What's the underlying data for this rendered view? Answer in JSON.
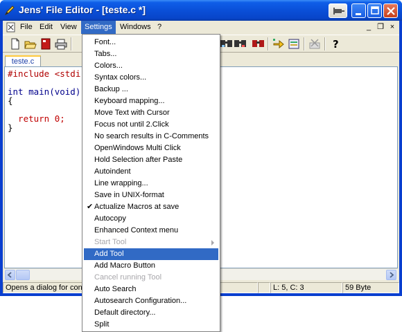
{
  "window": {
    "title": "Jens' File Editor - [teste.c *]"
  },
  "menubar": {
    "items": [
      "File",
      "Edit",
      "View",
      "Settings",
      "Windows",
      "?"
    ],
    "active": "Settings",
    "mdi_controls": [
      "_",
      "❐",
      "×"
    ]
  },
  "toolbar": {
    "icons": [
      "new-file-icon",
      "open-folder-icon",
      "close-file-icon",
      "print-icon",
      "find-icon",
      "find-next-icon",
      "binoculars-icon",
      "goto-icon",
      "macro-icon",
      "delete-tool-icon",
      "help-icon"
    ]
  },
  "tabs": [
    {
      "label": "teste.c",
      "active": true
    }
  ],
  "editor": {
    "lines": [
      {
        "text": "#include <stdi",
        "kind": "preprocessor"
      },
      {
        "text": "",
        "kind": "blank"
      },
      {
        "text": "int main(void)",
        "kind": "signature"
      },
      {
        "text": "{",
        "kind": "plain"
      },
      {
        "text": "",
        "kind": "blank"
      },
      {
        "text": "  return 0;",
        "kind": "return"
      },
      {
        "text": "}",
        "kind": "plain"
      }
    ]
  },
  "statusbar": {
    "message": "Opens a dialog for confi",
    "position": "L: 5, C: 3",
    "size": "59 Byte"
  },
  "settings_menu": {
    "items": [
      {
        "label": "Font...",
        "state": "normal"
      },
      {
        "label": "Tabs...",
        "state": "normal"
      },
      {
        "label": "Colors...",
        "state": "normal"
      },
      {
        "label": "Syntax colors...",
        "state": "normal"
      },
      {
        "label": "Backup ...",
        "state": "normal"
      },
      {
        "label": "Keyboard mapping...",
        "state": "normal"
      },
      {
        "label": "Move Text with Cursor",
        "state": "normal"
      },
      {
        "label": "Focus not until 2.Click",
        "state": "normal"
      },
      {
        "label": "No search results in C-Comments",
        "state": "normal"
      },
      {
        "label": "OpenWindows Multi Click",
        "state": "normal"
      },
      {
        "label": "Hold Selection after Paste",
        "state": "normal"
      },
      {
        "label": "Autoindent",
        "state": "normal"
      },
      {
        "label": "Line wrapping...",
        "state": "normal"
      },
      {
        "label": "Save in UNIX-format",
        "state": "normal"
      },
      {
        "label": "Actualize Macros at save",
        "state": "checked"
      },
      {
        "label": "Autocopy",
        "state": "normal"
      },
      {
        "label": "Enhanced Context menu",
        "state": "normal"
      },
      {
        "label": "Start Tool",
        "state": "disabled-submenu"
      },
      {
        "label": "Add Tool",
        "state": "highlighted"
      },
      {
        "label": "Add Macro Button",
        "state": "normal"
      },
      {
        "label": "Cancel running Tool",
        "state": "disabled"
      },
      {
        "label": "Auto Search",
        "state": "normal"
      },
      {
        "label": "Autosearch Configuration...",
        "state": "normal"
      },
      {
        "label": "Default directory...",
        "state": "normal"
      },
      {
        "label": "Split",
        "state": "normal"
      }
    ],
    "check_glyph": "✔"
  },
  "colors": {
    "titlebar": "#0a4fd8",
    "menu_highlight": "#316ac5",
    "disabled_text": "#a7a6aa",
    "preprocessor": "#b00000",
    "type_keyword": "#00008b"
  }
}
